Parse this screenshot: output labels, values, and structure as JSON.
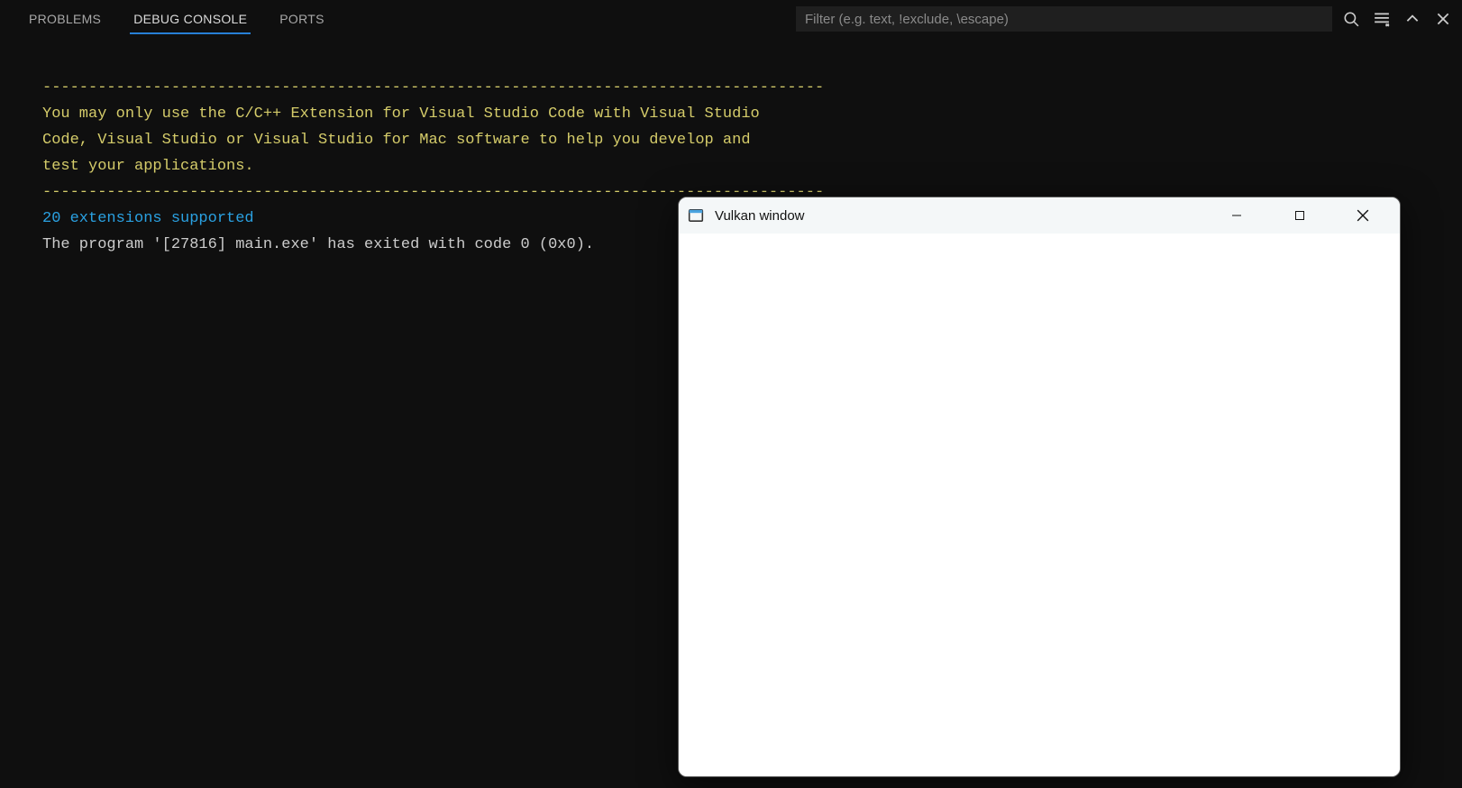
{
  "panel": {
    "tabs": [
      {
        "label": "PROBLEMS",
        "active": false
      },
      {
        "label": "DEBUG CONSOLE",
        "active": true
      },
      {
        "label": "PORTS",
        "active": false
      }
    ],
    "filter_placeholder": "Filter (e.g. text, !exclude, \\escape)"
  },
  "console": {
    "sep_top": "-------------------------------------------------------------------------------------",
    "license_line_1": "You may only use the C/C++ Extension for Visual Studio Code with Visual Studio",
    "license_line_2": "Code, Visual Studio or Visual Studio for Mac software to help you develop and",
    "license_line_3": "test your applications.",
    "sep_bottom": "-------------------------------------------------------------------------------------",
    "extensions_line": "20 extensions supported",
    "exit_line": "The program '[27816] main.exe' has exited with code 0 (0x0)."
  },
  "window": {
    "title": "Vulkan window"
  },
  "icons": {
    "search": "search-icon",
    "filter": "filter-lines-icon",
    "collapse_up": "chevron-up-icon",
    "close_panel": "close-icon",
    "win_app": "app-window-icon",
    "win_minimize": "minimize-icon",
    "win_maximize": "maximize-icon",
    "win_close": "close-icon"
  }
}
